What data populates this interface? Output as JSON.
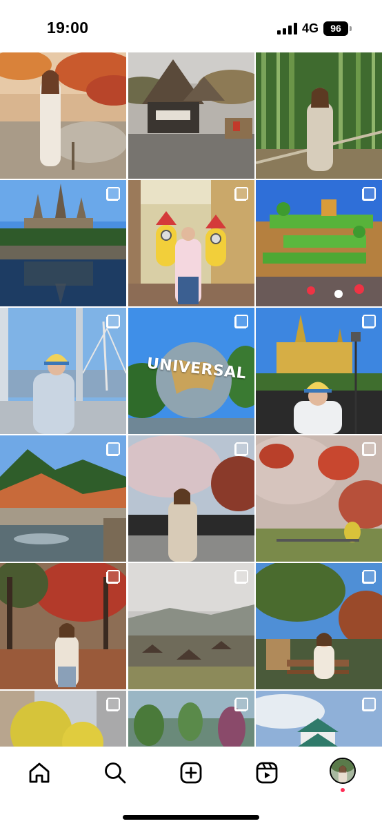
{
  "status_bar": {
    "time": "19:00",
    "network": "4G",
    "battery": "96"
  },
  "grid": {
    "tiles": [
      {
        "name": "autumn-garden-woman",
        "multi": false
      },
      {
        "name": "thatched-house-village",
        "multi": false
      },
      {
        "name": "bamboo-forest-woman",
        "multi": false
      },
      {
        "name": "hogwarts-castle-lake",
        "multi": true
      },
      {
        "name": "minions-studio-woman",
        "multi": true
      },
      {
        "name": "super-nintendo-world",
        "multi": true
      },
      {
        "name": "ferris-wheel-gondola",
        "multi": true
      },
      {
        "name": "universal-globe",
        "multi": true,
        "sign_text": "UNIVERSAL"
      },
      {
        "name": "hogwarts-castle-woman",
        "multi": true
      },
      {
        "name": "river-valley-autumn",
        "multi": true
      },
      {
        "name": "cherry-tree-woman",
        "multi": true
      },
      {
        "name": "red-maple-park",
        "multi": true
      },
      {
        "name": "autumn-forest-woman",
        "multi": true
      },
      {
        "name": "foggy-village-view",
        "multi": true
      },
      {
        "name": "park-bench-woman",
        "multi": true
      },
      {
        "name": "ginkgo-street-woman",
        "multi": true
      },
      {
        "name": "flower-garden-greenhouse",
        "multi": true
      },
      {
        "name": "nagoya-castle-woman",
        "multi": true
      }
    ]
  },
  "nav": {
    "items": [
      {
        "icon": "home-icon"
      },
      {
        "icon": "search-icon"
      },
      {
        "icon": "create-icon"
      },
      {
        "icon": "reels-icon"
      },
      {
        "icon": "profile-avatar"
      }
    ],
    "notification_dot_color": "#ff2d55"
  }
}
